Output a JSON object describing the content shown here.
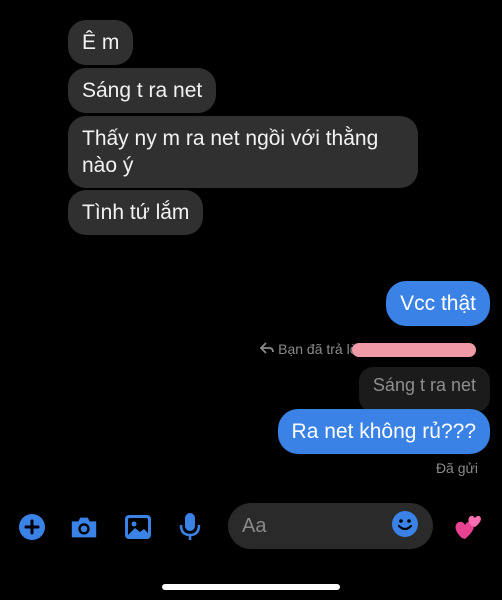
{
  "incoming": [
    {
      "text": "Ê m"
    },
    {
      "text": "Sáng t ra net"
    },
    {
      "text": "Thấy ny m ra net ngồi với thằng\nnào ý"
    },
    {
      "text": "Tình tứ lắm"
    }
  ],
  "outgoing": [
    {
      "text": "Vcc thật"
    },
    {
      "text": "Ra net không rủ???"
    }
  ],
  "reply": {
    "label": "Bạn đã trả lời",
    "quoted_text": "Sáng t ra net"
  },
  "status": {
    "seen_label": "Đã gửi"
  },
  "composer": {
    "placeholder": "Aa",
    "icons": [
      "plus-icon",
      "camera-icon",
      "image-icon",
      "microphone-icon",
      "emoji-icon",
      "hearts-icon"
    ]
  },
  "colors": {
    "accent": "#3a82e6",
    "incoming_bubble": "#303030",
    "redaction": "#ef9aa6"
  }
}
